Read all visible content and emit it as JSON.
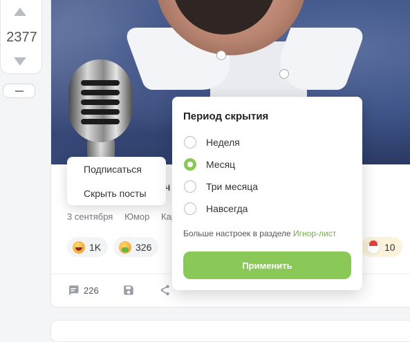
{
  "vote": {
    "count": "2377"
  },
  "post": {
    "title_fragment": "ч",
    "meta": [
      "3 сентября",
      "Юмор",
      "Карт"
    ],
    "reactions": [
      {
        "icon": "laughing-emoji-icon",
        "count": "1K"
      },
      {
        "icon": "sick-emoji-icon",
        "count": "326"
      },
      {
        "icon": "santa-emoji-icon",
        "count": "10"
      }
    ],
    "comments_count": "226"
  },
  "context_menu": {
    "items": [
      "Подписаться",
      "Скрыть посты"
    ]
  },
  "hide_popover": {
    "title": "Период скрытия",
    "options": [
      {
        "label": "Неделя",
        "selected": false
      },
      {
        "label": "Месяц",
        "selected": true
      },
      {
        "label": "Три месяца",
        "selected": false
      },
      {
        "label": "Навсегда",
        "selected": false
      }
    ],
    "more_text": "Больше настроек в разделе",
    "more_link": "Игнор-лист",
    "apply_label": "Применить"
  },
  "colors": {
    "accent": "#8ac858",
    "link": "#6fb03f"
  }
}
